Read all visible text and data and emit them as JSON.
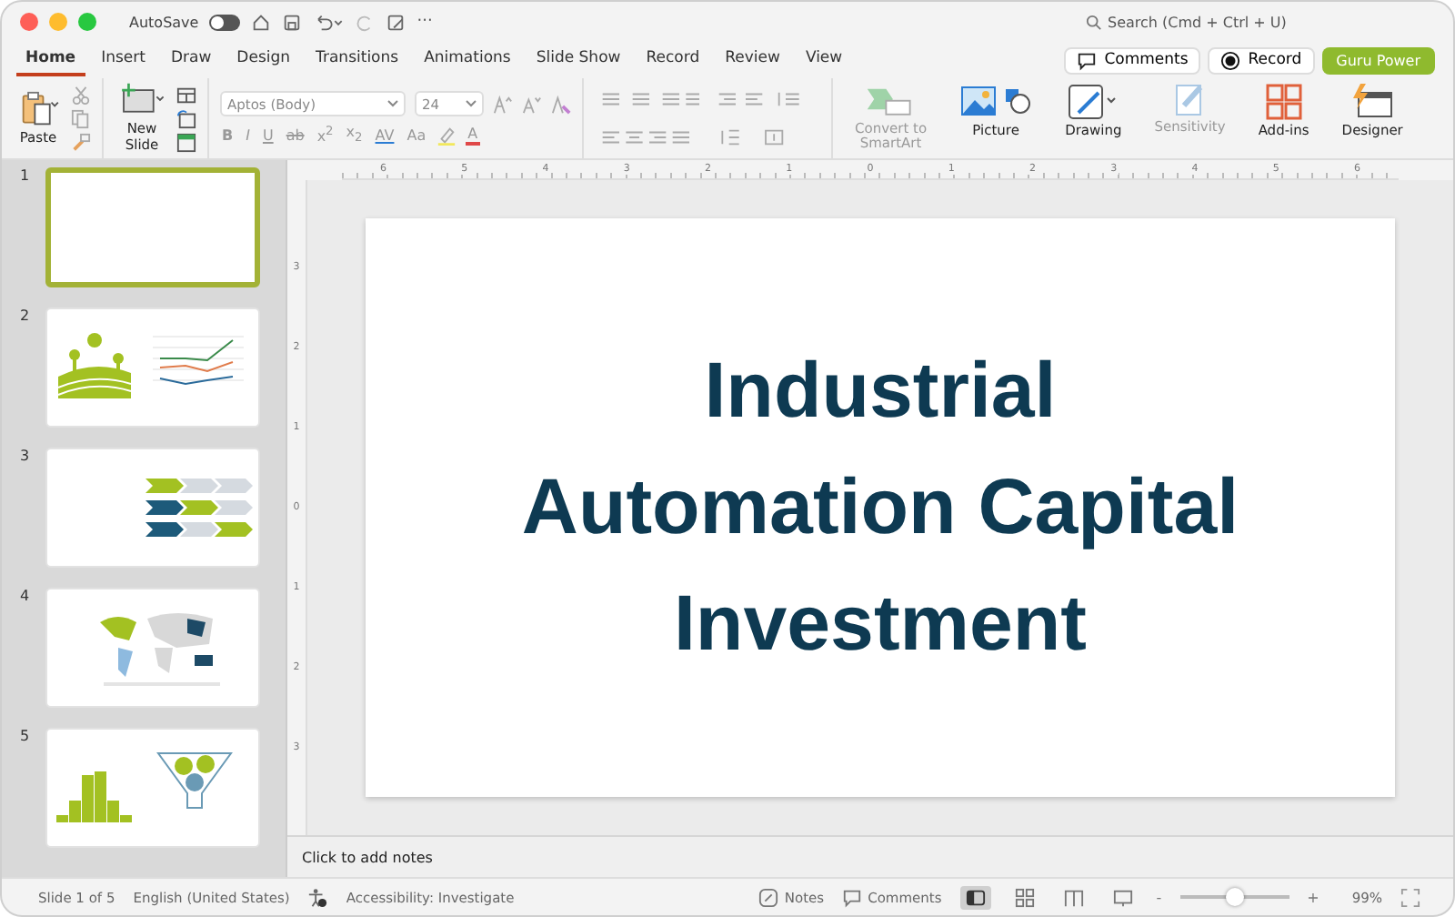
{
  "title_bar": {
    "autosave_label": "AutoSave",
    "autosave_on": false,
    "more": "···",
    "search_placeholder": "Search (Cmd + Ctrl + U)"
  },
  "tabs": [
    {
      "label": "Home",
      "selected": true
    },
    {
      "label": "Insert",
      "selected": false
    },
    {
      "label": "Draw",
      "selected": false
    },
    {
      "label": "Design",
      "selected": false
    },
    {
      "label": "Transitions",
      "selected": false
    },
    {
      "label": "Animations",
      "selected": false
    },
    {
      "label": "Slide Show",
      "selected": false
    },
    {
      "label": "Record",
      "selected": false
    },
    {
      "label": "Review",
      "selected": false
    },
    {
      "label": "View",
      "selected": false
    }
  ],
  "actions": {
    "comments": "Comments",
    "record": "Record",
    "share": "Guru Power"
  },
  "ribbon": {
    "paste": "Paste",
    "new_slide": "New\nSlide",
    "font": "Aptos (Body)",
    "font_size": "24",
    "format_glyphs": [
      {
        "kind": "bold",
        "text": "B"
      },
      {
        "kind": "italic",
        "text": "I"
      },
      {
        "kind": "underline",
        "text": "U"
      },
      {
        "kind": "strike",
        "text": "ab"
      },
      {
        "kind": "plain",
        "text": "x$^{2}$"
      },
      {
        "kind": "plain",
        "text": "x$_{2}$"
      },
      {
        "kind": "spacing",
        "text": "AV"
      },
      {
        "kind": "plain",
        "text": "Aa"
      }
    ],
    "font_color": "A",
    "buttons": [
      {
        "kind": "smartart",
        "label": "Convert to\nSmartArt",
        "disabled": true
      },
      {
        "kind": "picture",
        "label": "Picture",
        "disabled": false
      },
      {
        "kind": "drawing",
        "label": "Drawing",
        "disabled": false
      },
      {
        "kind": "sensitivity",
        "label": "Sensitivity",
        "disabled": true
      },
      {
        "kind": "addins",
        "label": "Add-ins",
        "disabled": false
      },
      {
        "kind": "designer",
        "label": "Designer",
        "disabled": false
      }
    ]
  },
  "rulers": {
    "horizontal": [
      "6",
      "5",
      "4",
      "3",
      "2",
      "1",
      "0",
      "1",
      "2",
      "3",
      "4",
      "5",
      "6"
    ],
    "vertical": [
      "3",
      "2",
      "1",
      "0",
      "1",
      "2",
      "3"
    ]
  },
  "slides": [
    {
      "number": "1",
      "kind": "title",
      "selected": true
    },
    {
      "number": "2",
      "kind": "landscape_chart",
      "selected": false
    },
    {
      "number": "3",
      "kind": "chevrons",
      "selected": false
    },
    {
      "number": "4",
      "kind": "map",
      "selected": false
    },
    {
      "number": "5",
      "kind": "histogram_funnel",
      "selected": false
    }
  ],
  "current_slide": {
    "title": "Industrial Automation Capital Investment"
  },
  "notes": {
    "placeholder": "Click to add notes"
  },
  "status_bar": {
    "slide": "Slide 1 of 5",
    "language": "English (United States)",
    "accessibility": "Accessibility: Investigate",
    "notes": "Notes",
    "comments": "Comments",
    "views": [
      {
        "kind": "normal",
        "selected": true
      },
      {
        "kind": "sorter",
        "selected": false
      },
      {
        "kind": "reading",
        "selected": false
      },
      {
        "kind": "presenter",
        "selected": false
      }
    ],
    "zoom_out": "-",
    "zoom_in": "+",
    "zoom": {
      "level": 0.5
    },
    "zoom_label": "99%"
  }
}
